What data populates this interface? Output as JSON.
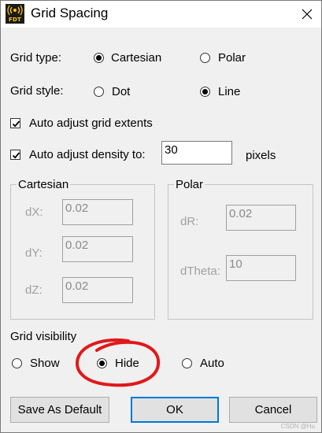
{
  "window": {
    "title": "Grid Spacing",
    "app_icon_text": "FDT",
    "close_glyph": "✕"
  },
  "grid_type": {
    "label": "Grid type:",
    "options": [
      "Cartesian",
      "Polar"
    ],
    "selected": "Cartesian"
  },
  "grid_style": {
    "label": "Grid style:",
    "options": [
      "Dot",
      "Line"
    ],
    "selected": "Line"
  },
  "auto_adjust_extents": {
    "label": "Auto adjust grid extents",
    "checked": true
  },
  "auto_adjust_density": {
    "label": "Auto adjust density to:",
    "checked": true,
    "value": "30",
    "unit": "pixels"
  },
  "cartesian": {
    "title": "Cartesian",
    "fields": [
      {
        "label": "dX:",
        "value": "0.02"
      },
      {
        "label": "dY:",
        "value": "0.02"
      },
      {
        "label": "dZ:",
        "value": "0.02"
      }
    ]
  },
  "polar": {
    "title": "Polar",
    "fields": [
      {
        "label": "dR:",
        "value": "0.02"
      },
      {
        "label": "dTheta:",
        "value": "10"
      }
    ]
  },
  "grid_visibility": {
    "label": "Grid visibility",
    "options": [
      "Show",
      "Hide",
      "Auto"
    ],
    "selected": "Hide"
  },
  "buttons": {
    "save_default": "Save As Default",
    "ok": "OK",
    "cancel": "Cancel"
  },
  "colors": {
    "annotation_circle": "#e0191b",
    "default_button_border": "#0078d7"
  },
  "watermark": "CSDN @Hu"
}
